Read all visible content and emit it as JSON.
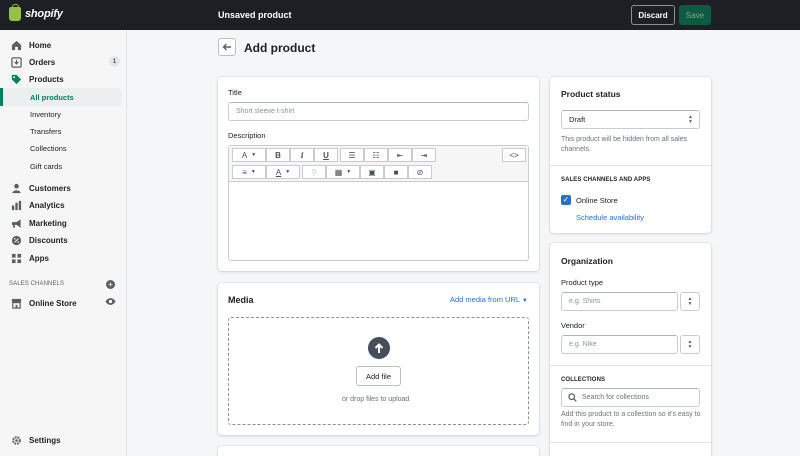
{
  "topbar": {
    "logo_text": "shopify",
    "title": "Unsaved product",
    "discard_label": "Discard",
    "save_label": "Save"
  },
  "sidebar": {
    "items": [
      {
        "label": "Home",
        "icon": "home-icon"
      },
      {
        "label": "Orders",
        "icon": "orders-icon",
        "badge": "1"
      },
      {
        "label": "Products",
        "icon": "tag-icon"
      },
      {
        "label": "Customers",
        "icon": "customer-icon"
      },
      {
        "label": "Analytics",
        "icon": "analytics-icon"
      },
      {
        "label": "Marketing",
        "icon": "marketing-icon"
      },
      {
        "label": "Discounts",
        "icon": "discount-icon"
      },
      {
        "label": "Apps",
        "icon": "apps-icon"
      }
    ],
    "product_subitems": [
      "All products",
      "Inventory",
      "Transfers",
      "Collections",
      "Gift cards"
    ],
    "active_subitem": "All products",
    "sales_channels_label": "SALES CHANNELS",
    "online_store_label": "Online Store",
    "settings_label": "Settings"
  },
  "page": {
    "title": "Add product"
  },
  "product_form": {
    "title_label": "Title",
    "title_placeholder": "Short sleeve t-shirt",
    "description_label": "Description",
    "html_toggle": "<>"
  },
  "media": {
    "title": "Media",
    "add_from_url": "Add media from URL",
    "add_file_label": "Add file",
    "drop_text": "or drop files to upload"
  },
  "product_status": {
    "title": "Product status",
    "selected": "Draft",
    "help": "This product will be hidden from all sales channels.",
    "channels_heading": "SALES CHANNELS AND APPS",
    "channel_name": "Online Store",
    "channel_checked": true,
    "schedule_link": "Schedule availability"
  },
  "organization": {
    "title": "Organization",
    "product_type_label": "Product type",
    "product_type_placeholder": "e.g. Shirts",
    "vendor_label": "Vendor",
    "vendor_placeholder": "e.g. Nike",
    "collections_heading": "COLLECTIONS",
    "collections_placeholder": "Search for collections",
    "collections_help": "Add this product to a collection so it's easy to find in your store."
  },
  "colors": {
    "accent": "#008060",
    "link": "#2c6ecb",
    "topbar": "#1c2025"
  }
}
